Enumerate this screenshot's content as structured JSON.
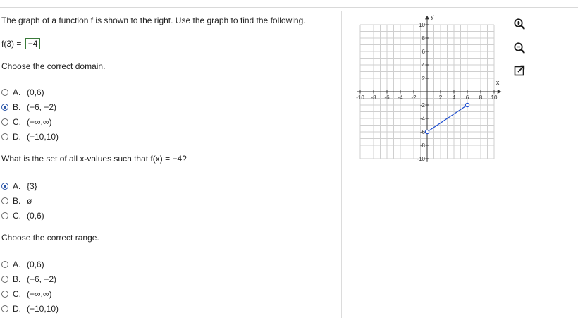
{
  "question": {
    "intro": "The graph of a function f is shown to the right. Use the graph to find the following.",
    "f3_label": "f(3) =",
    "f3_value": "−4",
    "domain_prompt": "Choose the correct domain.",
    "domain_options": [
      {
        "letter": "A.",
        "text": "(0,6)",
        "selected": false
      },
      {
        "letter": "B.",
        "text": "(−6, −2)",
        "selected": true
      },
      {
        "letter": "C.",
        "text": "(−∞,∞)",
        "selected": false
      },
      {
        "letter": "D.",
        "text": "(−10,10)",
        "selected": false
      }
    ],
    "xset_prompt": "What is the set of all x-values such that f(x) = −4?",
    "xset_options": [
      {
        "letter": "A.",
        "text": "{3}",
        "selected": true
      },
      {
        "letter": "B.",
        "text": "ø",
        "selected": false
      },
      {
        "letter": "C.",
        "text": "(0,6)",
        "selected": false
      }
    ],
    "range_prompt": "Choose the correct range.",
    "range_options": [
      {
        "letter": "A.",
        "text": "(0,6)",
        "selected": false
      },
      {
        "letter": "B.",
        "text": "(−6, −2)",
        "selected": false
      },
      {
        "letter": "C.",
        "text": "(−∞,∞)",
        "selected": false
      },
      {
        "letter": "D.",
        "text": "(−10,10)",
        "selected": false
      }
    ]
  },
  "graph": {
    "x_axis_label": "x",
    "y_axis_label": "y",
    "x_ticks": [
      "-10",
      "-8",
      "-6",
      "-4",
      "-2",
      "2",
      "4",
      "6",
      "8",
      "10"
    ],
    "y_ticks": [
      "10",
      "8",
      "6",
      "4",
      "2",
      "-2",
      "-4",
      "-6",
      "-8",
      "-10"
    ],
    "segment": {
      "x1": 0,
      "y1": -6,
      "x2": 6,
      "y2": -2,
      "open_start": true,
      "open_end": true
    },
    "line_color": "#1f4fd1"
  },
  "tools": [
    "zoom-in-icon",
    "zoom-out-icon",
    "popout-icon"
  ],
  "colors": {
    "selected_radio": "#2a55a8",
    "answer_box_border": "#3a7a3a"
  }
}
